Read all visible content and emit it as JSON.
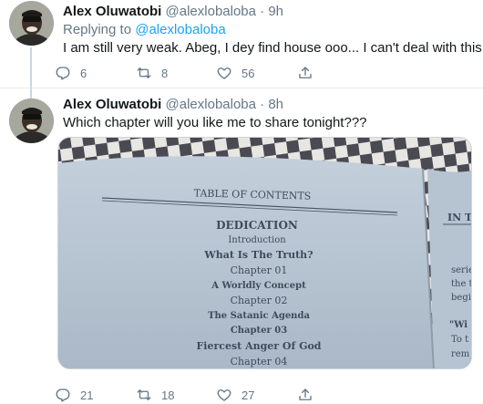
{
  "tweets": [
    {
      "name": "Alex Oluwatobi",
      "handle": "@alexlobaloba",
      "separator": "·",
      "time": "9h",
      "replying_prefix": "Replying to",
      "replying_to": "@alexlobaloba",
      "text": "I am still very weak. Abeg, I dey find house ooo... I can't deal with this.",
      "replies": "6",
      "retweets": "8",
      "likes": "56"
    },
    {
      "name": "Alex Oluwatobi",
      "handle": "@alexlobaloba",
      "separator": "·",
      "time": "8h",
      "text": "Which chapter will you like me to share tonight???",
      "replies": "21",
      "retweets": "18",
      "likes": "27",
      "photo": {
        "heading": "TABLE OF CONTENTS",
        "lines": [
          "DEDICATION",
          "Introduction",
          "What Is The Truth?",
          "Chapter 01",
          "A Worldly Concept",
          "Chapter 02",
          "The Satanic Agenda",
          "Chapter 03",
          "Fiercest Anger Of God",
          "Chapter 04"
        ],
        "right_page": [
          "IN T",
          "serie",
          "the t",
          "begi",
          "\"Wi",
          "To t",
          "rem"
        ]
      }
    }
  ],
  "icons": {
    "reply": "reply-icon",
    "retweet": "retweet-icon",
    "like": "heart-icon",
    "share": "share-icon"
  },
  "colors": {
    "text": "#14171a",
    "muted": "#657786",
    "link": "#1da1f2",
    "divider": "#e6ecf0",
    "page_paper": "#b9c6d3"
  }
}
